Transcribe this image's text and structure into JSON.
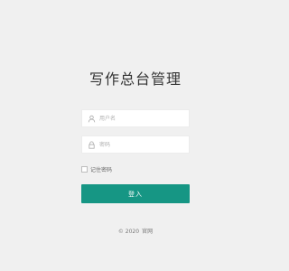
{
  "title": "写作总台管理",
  "form": {
    "username_placeholder": "用户名",
    "username_value": "",
    "password_placeholder": "密码",
    "password_value": "",
    "remember_label": "记住密码",
    "remember_checked": false,
    "login_label": "登入"
  },
  "footer": {
    "copyright": "© 2020",
    "site": "官网"
  },
  "icons": {
    "username": "user-icon",
    "password": "lock-icon"
  },
  "colors": {
    "background": "#f0f0f0",
    "accent": "#169684"
  }
}
